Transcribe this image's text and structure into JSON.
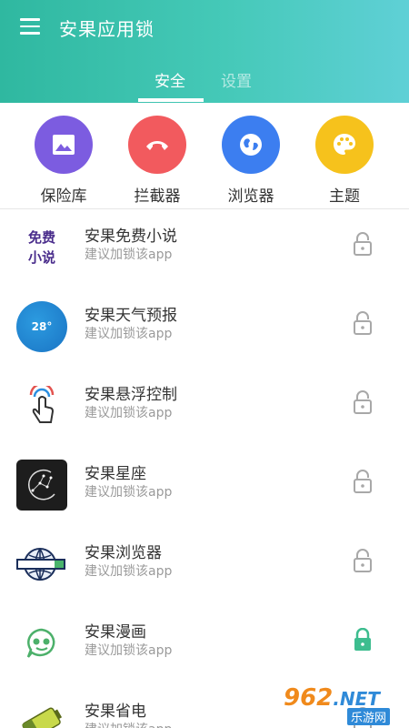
{
  "header": {
    "title": "安果应用锁",
    "menu_icon": "hamburger-menu-icon",
    "tabs": [
      {
        "label": "安全",
        "active": true
      },
      {
        "label": "设置",
        "active": false
      }
    ],
    "gradient_colors": [
      "#2fb8a0",
      "#5fd0d6"
    ]
  },
  "quick_actions": [
    {
      "label": "保险库",
      "icon": "image-icon",
      "color": "#7c5ce0"
    },
    {
      "label": "拦截器",
      "icon": "phone-hangup-icon",
      "color": "#f25a5e"
    },
    {
      "label": "浏览器",
      "icon": "globe-icon",
      "color": "#3c7ef0"
    },
    {
      "label": "主题",
      "icon": "palette-icon",
      "color": "#f6c21c"
    }
  ],
  "apps": [
    {
      "name": "安果免费小说",
      "subtitle": "建议加锁该app",
      "icon_text": [
        "免费",
        "小说"
      ],
      "locked": false
    },
    {
      "name": "安果天气预报",
      "subtitle": "建议加锁该app",
      "icon_text": [
        "28°"
      ],
      "locked": false
    },
    {
      "name": "安果悬浮控制",
      "subtitle": "建议加锁该app",
      "locked": false
    },
    {
      "name": "安果星座",
      "subtitle": "建议加锁该app",
      "locked": false
    },
    {
      "name": "安果浏览器",
      "subtitle": "建议加锁该app",
      "locked": false
    },
    {
      "name": "安果漫画",
      "subtitle": "建议加锁该app",
      "locked": true
    },
    {
      "name": "安果省电",
      "subtitle": "建议加锁该app",
      "locked": false
    }
  ],
  "lock_colors": {
    "locked": "#3dbd8f",
    "unlocked": "#a8a8a8"
  },
  "watermark": {
    "brand": "962",
    "suffix": ".NET",
    "caption": "乐游网"
  }
}
